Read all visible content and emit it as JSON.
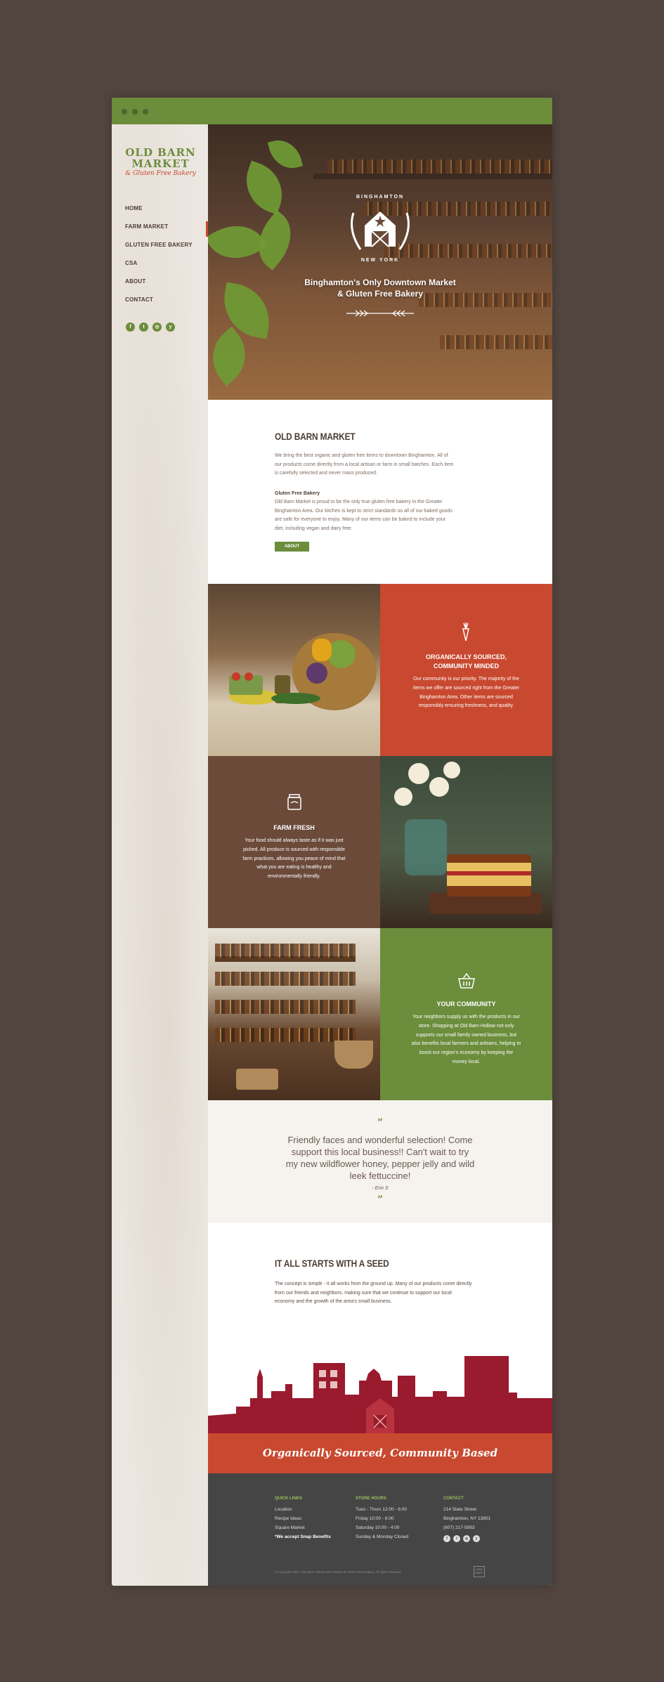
{
  "brand": {
    "logo_line1": "OLD BARN",
    "logo_line2": "MARKET",
    "logo_line3": "& Gluten Free Bakery"
  },
  "nav": {
    "items": [
      {
        "label": "HOME"
      },
      {
        "label": "FARM MARKET"
      },
      {
        "label": "GLUTEN FREE BAKERY"
      },
      {
        "label": "CSA"
      },
      {
        "label": "ABOUT"
      },
      {
        "label": "CONTACT"
      }
    ],
    "active": "HOME"
  },
  "social": [
    {
      "icon": "facebook-icon",
      "glyph": "f"
    },
    {
      "icon": "twitter-icon",
      "glyph": "t"
    },
    {
      "icon": "instagram-icon",
      "glyph": "◎"
    },
    {
      "icon": "yelp-icon",
      "glyph": "y"
    }
  ],
  "hero": {
    "emblem_top": "BINGHAMTON",
    "emblem_bottom": "NEW YORK",
    "tagline_line1": "Binghamton's Only Downtown Market",
    "tagline_line2": "& Gluten Free Bakery"
  },
  "about": {
    "title": "OLD BARN MARKET",
    "p1_line1": "We bring the best organic and gluten free items to downtown Binghamton. All of",
    "p1_line2": "our products come directly from a local artisan or farm in small batches. Each item",
    "p1_line3": "is carefully selected and never mass produced.",
    "subhead": "Gluten Free Bakery",
    "p2_line1": "Old Barn Market is proud to be the only true gluten free bakery in the Greater",
    "p2_line2": "Binghamton Area. Our kitchen is kept to strict standards so all of our baked goods",
    "p2_line3": "are safe for everyone to enjoy. Many of our items can be baked to include your",
    "p2_line4": "diet, including vegan and dairy free.",
    "button": "ABOUT"
  },
  "features": {
    "organic": {
      "title_line1": "ORGANICALLY SOURCED,",
      "title_line2": "COMMUNITY MINDED",
      "body_line1": "Our community is our priority. The majority of the",
      "body_line2": "items we offer are sourced right from the Greater",
      "body_line3": "Binghamton Area. Other items are sourced",
      "body_line4": "responsibly ensuring freshness, and quality."
    },
    "fresh": {
      "title": "FARM FRESH",
      "body_line1": "Your food should always taste as if it was just",
      "body_line2": "picked.  All produce is sourced with responsible",
      "body_line3": "farm practices, allowing you peace of mind that",
      "body_line4": "what you are eating is healthy and",
      "body_line5": "environmentally friendly."
    },
    "community": {
      "title": "YOUR COMMUNITY",
      "body_line1": "Your neighbors supply us with the products in our",
      "body_line2": "store. Shopping at Old Barn Hollow not only",
      "body_line3": "supports our small family owned business, but",
      "body_line4": "also benefits local farmers and artisans, helping to",
      "body_line5": "boost our region's economy by keeping the",
      "body_line6": "money local."
    }
  },
  "testimonial": {
    "open_quote": "“",
    "line1": "Friendly faces and wonderful selection! Come",
    "line2": "support this local business!! Can't wait to try",
    "line3": "my new wildflower honey, pepper jelly and wild",
    "line4": "leek fettuccine!",
    "author": "- Erin S",
    "close_quote": "”"
  },
  "seed": {
    "title": "IT ALL STARTS WITH A SEED",
    "line1": "The concept is simple - it all works from the ground up. Many of our products come directly",
    "line2": "from our friends and neighbors, making sure that we continue to support our local",
    "line3": "economy and the growth of the area's small business."
  },
  "banner": {
    "text": "Organically Sourced, Community Based"
  },
  "footer": {
    "quick_links": {
      "heading": "QUICK LINKS",
      "items": [
        "Location",
        "Recipe Ideas",
        "Square Market",
        "*We accept Snap Benefits"
      ]
    },
    "store_hours": {
      "heading": "STORE HOURS",
      "items": [
        "Tues - Thurs 12:00 - 6:00",
        "Friday 10:00 - 6:00",
        "Saturday 10:00 - 4:00",
        "Sunday & Monday Closed"
      ]
    },
    "contact": {
      "heading": "CONTACT",
      "items": [
        "214 State Street",
        "Binghamton, NY 13901",
        "(607) 217-5993"
      ]
    },
    "copyright": "© Copyright 2017. Old Barn Hollow Farm Market & Gluten Free Bakery. All rights reserved.",
    "badge": "COLE CRAFT"
  },
  "colors": {
    "green": "#6b8d3c",
    "red": "#c8492f",
    "brown": "#6b4a3a",
    "dark": "#454545",
    "maroon": "#9a1a2e"
  }
}
